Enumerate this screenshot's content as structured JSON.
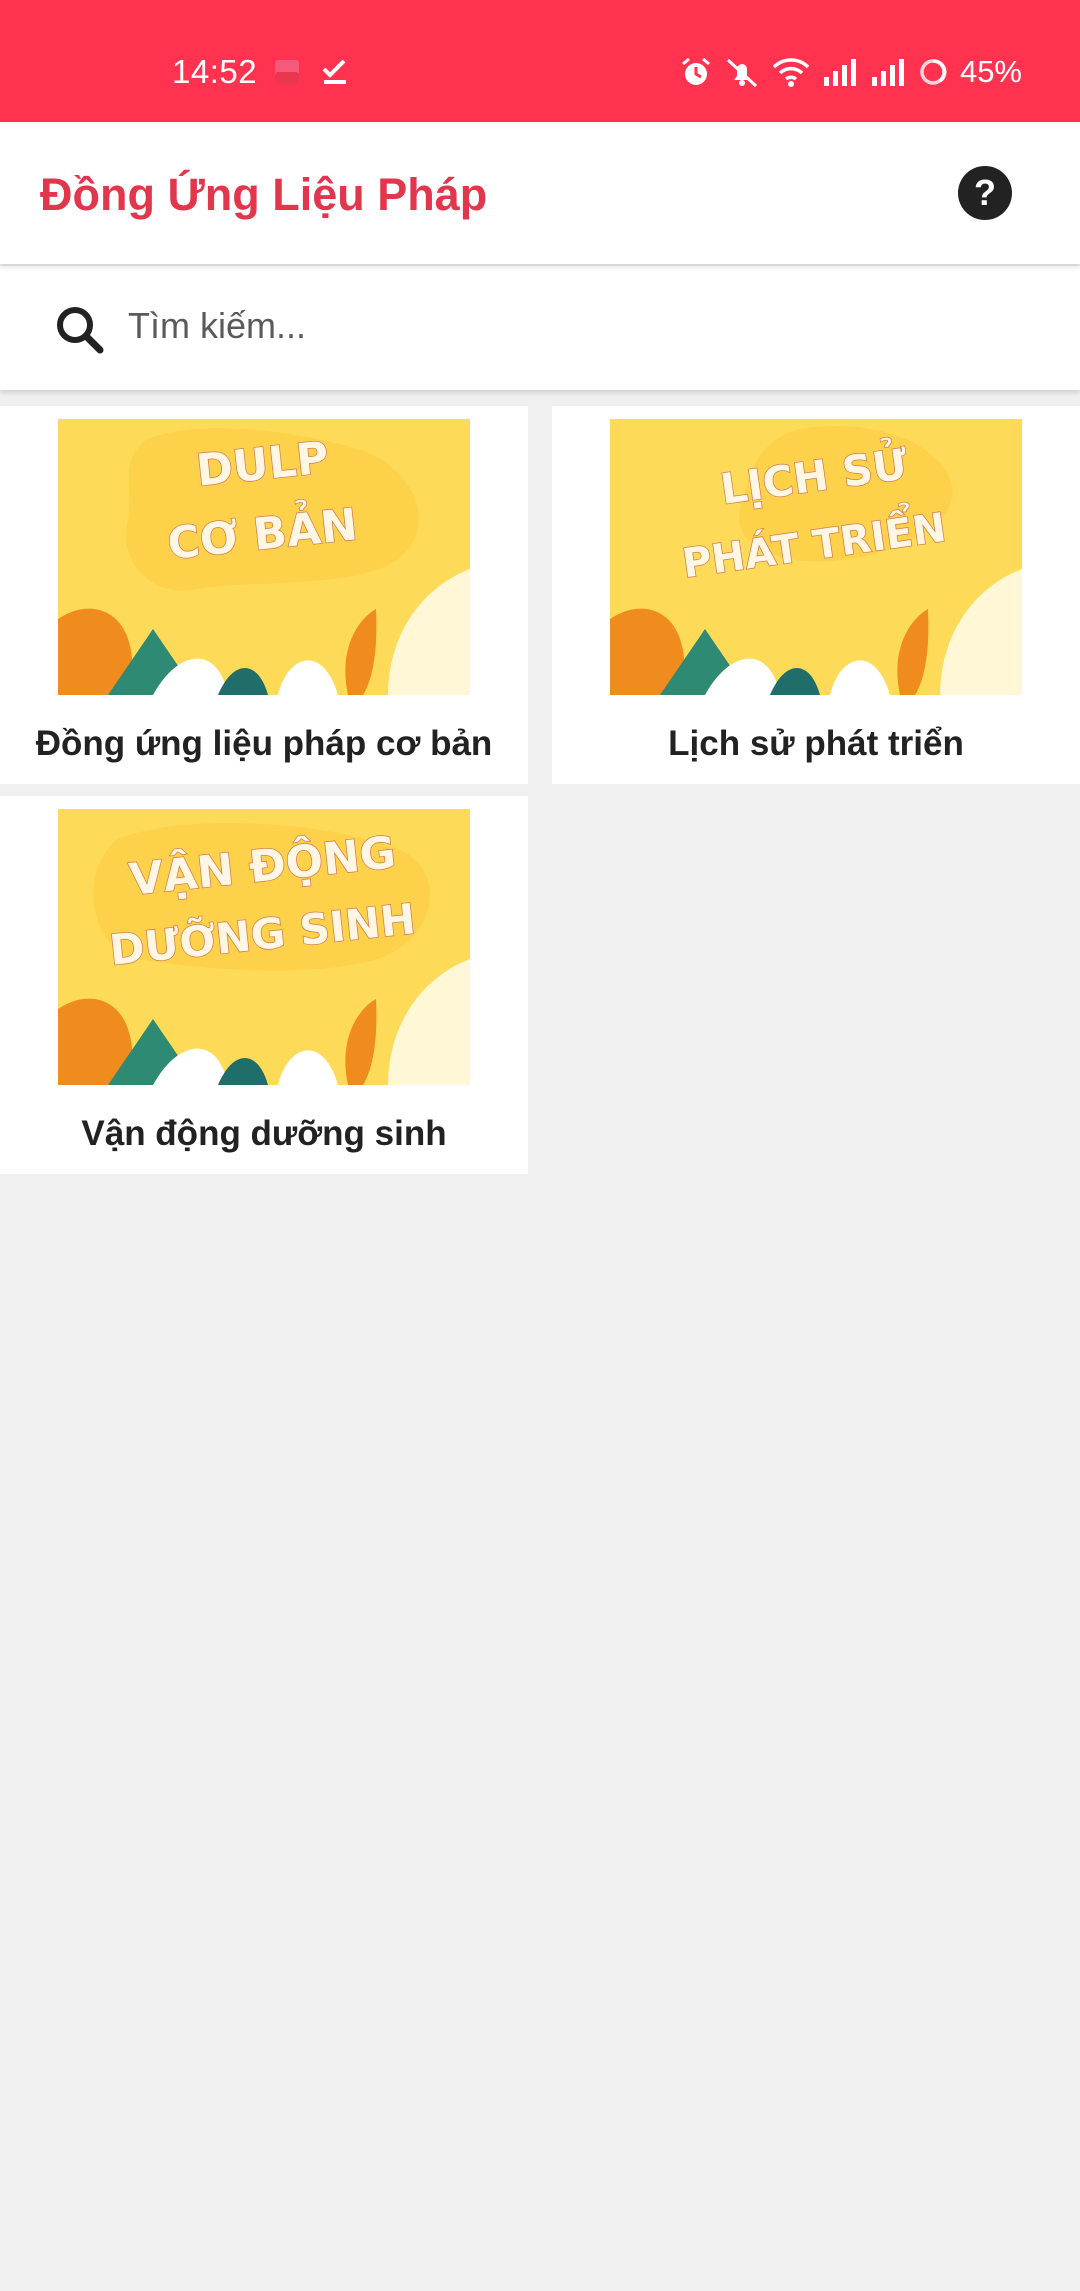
{
  "status_bar": {
    "time": "14:52",
    "battery": "45%",
    "icons": [
      "notification-app-icon",
      "task-check-icon",
      "alarm-icon",
      "mute-icon",
      "wifi-icon",
      "signal-icon",
      "signal-icon",
      "battery-icon"
    ]
  },
  "app_bar": {
    "title": "Đồng Ứng Liệu Pháp",
    "help_icon": "question-circle-icon",
    "help_label": "?"
  },
  "search": {
    "placeholder": "Tìm kiếm...",
    "value": "",
    "icon": "search-icon"
  },
  "colors": {
    "status_bar": "#ff334f",
    "accent": "#e2364c",
    "background": "#f0f0f0",
    "card": "#ffffff",
    "thumbnail_yellow": "#fddb58"
  },
  "categories": [
    {
      "label": "Đồng ứng liệu pháp cơ bản",
      "image_text": [
        "DULP",
        "CƠ BẢN"
      ]
    },
    {
      "label": "Lịch sử phát triển",
      "image_text": [
        "LỊCH SỬ",
        "PHÁT TRIỂN"
      ]
    },
    {
      "label": "Vận động dưỡng sinh",
      "image_text": [
        "VẬN ĐỘNG",
        "DƯỠNG SINH"
      ]
    }
  ]
}
